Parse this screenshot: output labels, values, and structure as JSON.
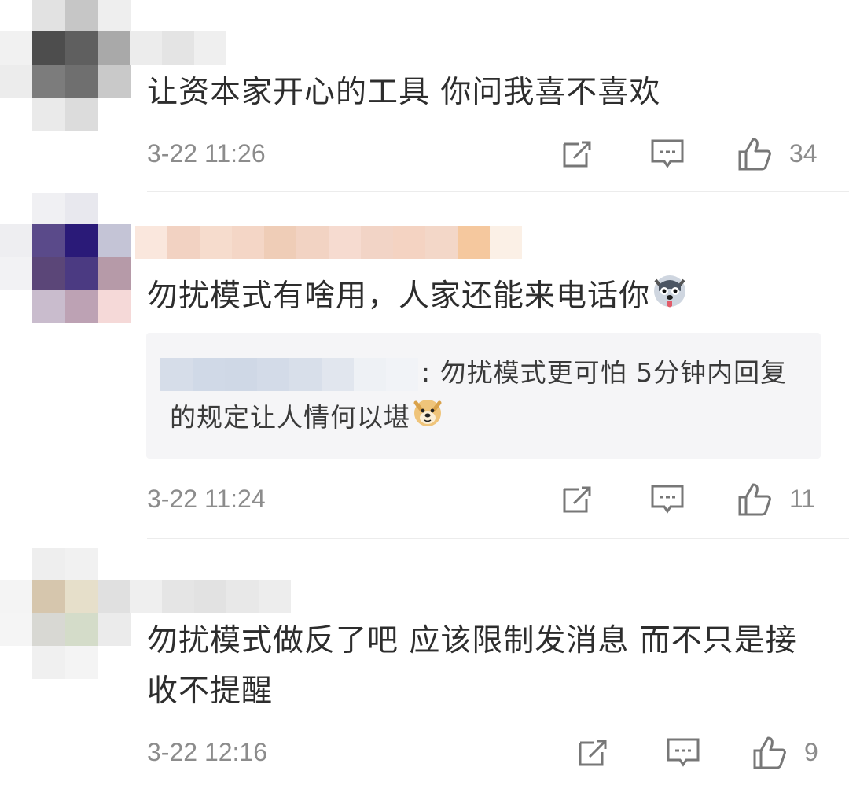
{
  "comments": [
    {
      "text": "让资本家开心的工具 你问我喜不喜欢",
      "time": "3-22 11:26",
      "likes": "34"
    },
    {
      "text": "勿扰模式有啥用，人家还能来电话你",
      "text_emoji": "husky-emoji",
      "quote": {
        "text": ": 勿扰模式更可怕 5分钟内回复的规定让人情何以堪",
        "emoji": "doge-emoji"
      },
      "time": "3-22 11:24",
      "likes": "11"
    },
    {
      "text": "勿扰模式做反了吧 应该限制发消息 而不只是接收不提醒",
      "time": "3-22 12:16",
      "likes": "9"
    }
  ],
  "icons": [
    "share-icon",
    "reply-icon",
    "like-icon"
  ],
  "colors": {
    "meta_text": "#8c8c8c",
    "quote_bg": "#f5f5f7",
    "divider": "#ececec"
  }
}
